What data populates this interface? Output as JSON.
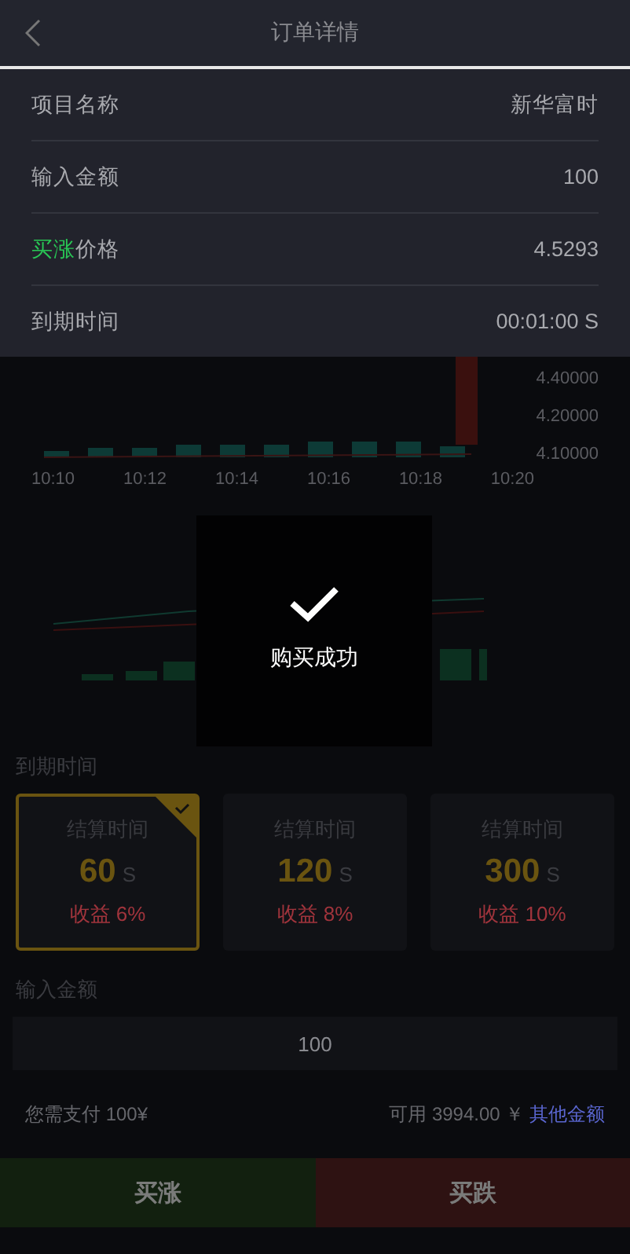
{
  "header": {
    "title": "订单详情"
  },
  "order_details": [
    {
      "label": "项目名称",
      "value": "新华富时"
    },
    {
      "label": "输入金额",
      "value": "100"
    },
    {
      "tag": "买涨",
      "label": "价格",
      "value": "4.5293"
    },
    {
      "label": "到期时间",
      "value": "00:01:00 S"
    }
  ],
  "chart": {
    "time_labels": [
      "10:10",
      "10:12",
      "10:14",
      "10:16",
      "10:18",
      "10:20"
    ],
    "price_labels": [
      "4.40000",
      "4.20000",
      "4.10000"
    ]
  },
  "toast": {
    "message": "购买成功"
  },
  "expiry": {
    "title": "到期时间",
    "options": [
      {
        "caption": "结算时间",
        "seconds": "60",
        "unit": "S",
        "yield": "收益 6%",
        "selected": true
      },
      {
        "caption": "结算时间",
        "seconds": "120",
        "unit": "S",
        "yield": "收益 8%",
        "selected": false
      },
      {
        "caption": "结算时间",
        "seconds": "300",
        "unit": "S",
        "yield": "收益 10%",
        "selected": false
      }
    ]
  },
  "amount": {
    "title": "输入金额",
    "value": "100"
  },
  "payment": {
    "due": "您需支付 100¥",
    "available": "可用 3994.00 ￥",
    "link": "其他金额"
  },
  "actions": [
    {
      "kind": "up",
      "label": "买涨"
    },
    {
      "kind": "down",
      "label": "买跌"
    }
  ]
}
